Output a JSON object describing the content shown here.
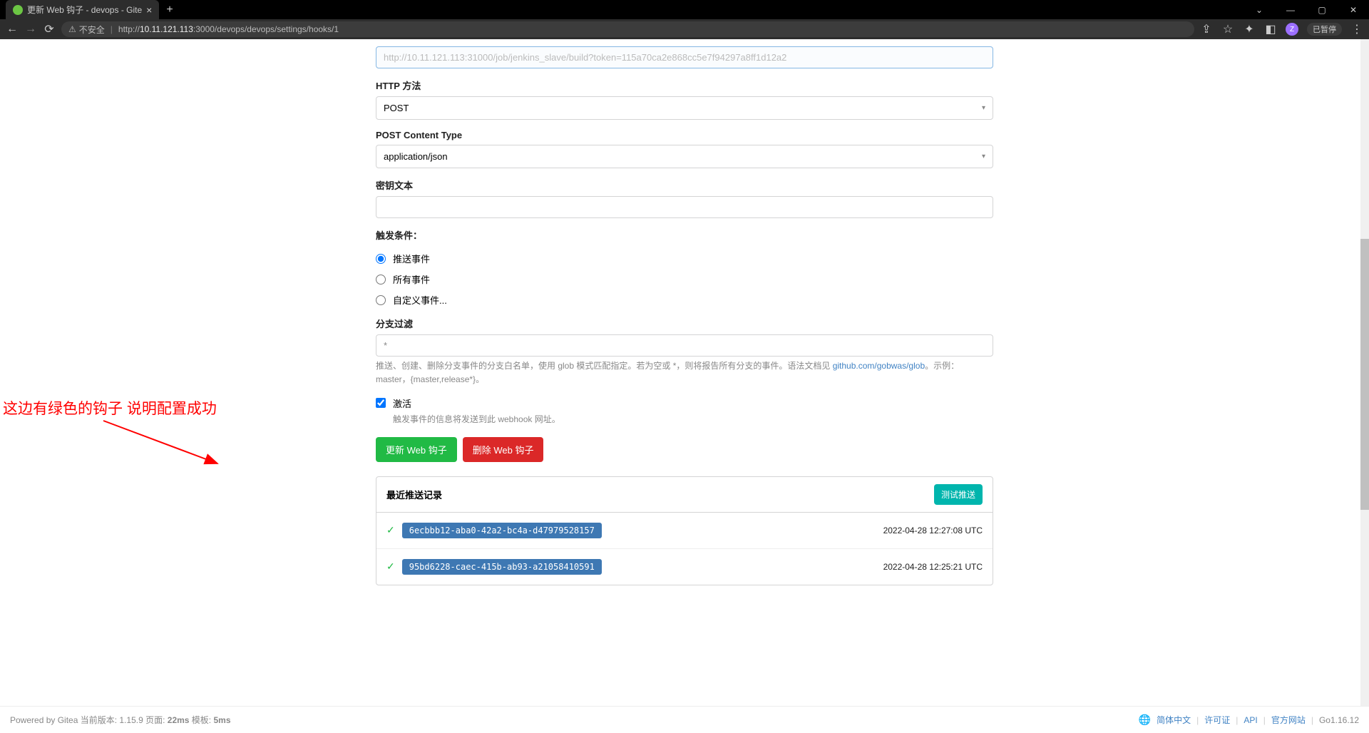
{
  "browser": {
    "tab_title": "更新 Web 钩子 - devops - Gite",
    "security_label": "不安全",
    "url_prefix": "http://",
    "url_host": "10.11.121.113",
    "url_path": ":3000/devops/devops/settings/hooks/1",
    "avatar_letter": "Z",
    "pause_label": "已暂停"
  },
  "form": {
    "target_url_value": "http://10.11.121.113:31000/job/jenkins_slave/build?token=115a70ca2e868cc5e7f94297a8ff1d12a2",
    "http_method_label": "HTTP 方法",
    "http_method_value": "POST",
    "content_type_label": "POST Content Type",
    "content_type_value": "application/json",
    "secret_label": "密钥文本",
    "trigger_label": "触发条件：",
    "radio_push": "推送事件",
    "radio_all": "所有事件",
    "radio_custom": "自定义事件...",
    "branch_filter_label": "分支过滤",
    "branch_filter_value": "*",
    "branch_help_1": "推送、创建、删除分支事件的分支白名单，使用 glob 模式匹配指定。若为空或 *，则将报告所有分支的事件。语法文档见 ",
    "branch_help_link": "github.com/gobwas/glob",
    "branch_help_2": "。示例：master，{master,release*}。",
    "active_label": "激活",
    "active_help": "触发事件的信息将发送到此 webhook 网址。",
    "btn_update": "更新 Web 钩子",
    "btn_delete": "删除 Web 钩子"
  },
  "deliveries": {
    "title": "最近推送记录",
    "test_btn": "测试推送",
    "items": [
      {
        "uuid": "6ecbbb12-aba0-42a2-bc4a-d47979528157",
        "time": "2022-04-28 12:27:08 UTC"
      },
      {
        "uuid": "95bd6228-caec-415b-ab93-a21058410591",
        "time": "2022-04-28 12:25:21 UTC"
      }
    ]
  },
  "annotation": "这边有绿色的钩子 说明配置成功",
  "footer": {
    "powered_prefix": "Powered by Gitea 当前版本: 1.15.9 页面: ",
    "timing1": "22ms",
    "timing_mid": " 模板: ",
    "timing2": "5ms",
    "lang": "简体中文",
    "license": "许可证",
    "api": "API",
    "website": "官方网站",
    "go_version": "Go1.16.12"
  }
}
